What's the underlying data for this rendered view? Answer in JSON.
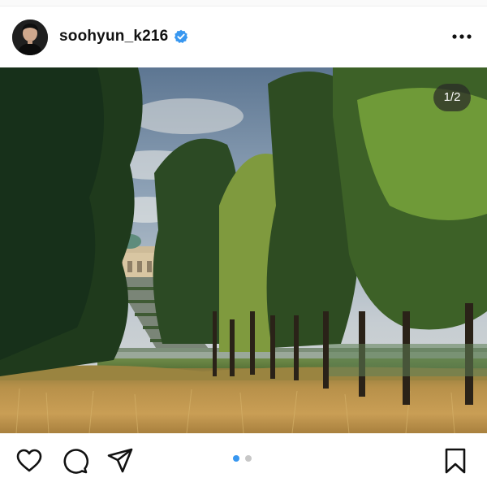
{
  "post": {
    "username": "soohyun_k216",
    "verified": true,
    "image_counter": "1/2",
    "carousel": {
      "total": 2,
      "active": 1
    }
  },
  "icons": {
    "verified": "verified-badge-icon",
    "more": "more-options-icon",
    "like": "heart-icon",
    "comment": "comment-icon",
    "share": "paper-plane-icon",
    "save": "bookmark-icon"
  },
  "colors": {
    "verified_blue": "#3897f0",
    "active_dot": "#3897f0",
    "inactive_dot": "#c7c7c7",
    "text": "#111111"
  }
}
